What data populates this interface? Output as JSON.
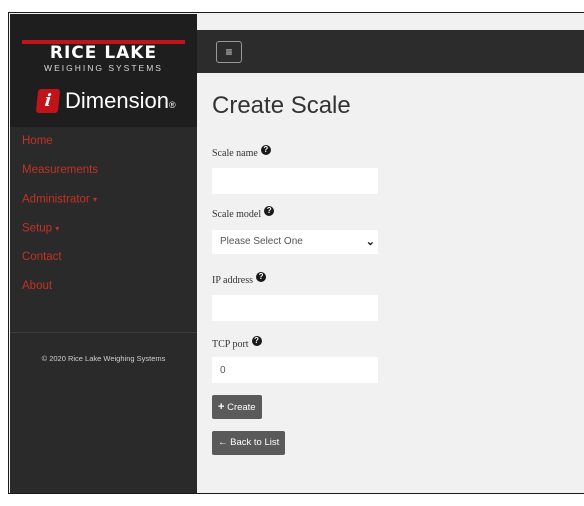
{
  "brand": {
    "company": "RICE LAKE",
    "tagline": "WEIGHING SYSTEMS",
    "product_logo_letter": "i",
    "product": "Dimension",
    "product_mark": "®"
  },
  "sidebar": {
    "items": [
      {
        "label": "Home"
      },
      {
        "label": "Measurements"
      },
      {
        "label": "Administrator",
        "caret": "▾"
      },
      {
        "label": "Setup",
        "caret": "▾"
      },
      {
        "label": "Contact"
      },
      {
        "label": "About"
      }
    ],
    "copyright": "© 2020 Rice Lake Weighing Systems"
  },
  "topbar": {
    "menu_icon": "≡"
  },
  "page": {
    "title": "Create Scale"
  },
  "form": {
    "help_glyph": "?",
    "scale_name": {
      "label": "Scale name",
      "value": ""
    },
    "scale_model": {
      "label": "Scale model",
      "value": "Please Select One",
      "chevron": "⌄"
    },
    "ip_address": {
      "label": "IP address",
      "value": ""
    },
    "tcp_port": {
      "label": "TCP port",
      "value": "0"
    }
  },
  "buttons": {
    "create": {
      "icon": "+",
      "label": "Create"
    },
    "back": {
      "icon": "←",
      "label": "Back to List"
    }
  },
  "colors": {
    "sidebar_bg": "#2a2a2a",
    "nav_link": "#c23225",
    "brand_red": "#c0141a",
    "button_bg": "#5a5a5a"
  }
}
